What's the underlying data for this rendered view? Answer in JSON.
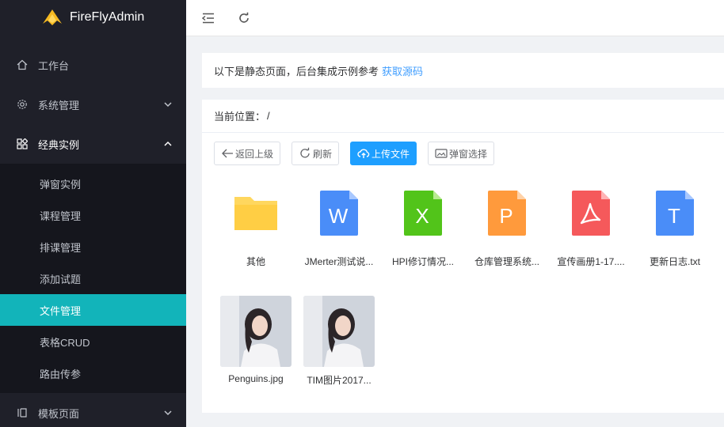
{
  "app": {
    "title": "FireFlyAdmin"
  },
  "sidebar": {
    "items": [
      {
        "label": "工作台",
        "icon": "home-icon"
      },
      {
        "label": "系统管理",
        "icon": "gear-icon"
      },
      {
        "label": "经典实例",
        "icon": "grid-icon",
        "open": true
      },
      {
        "label": "模板页面",
        "icon": "template-icon"
      }
    ],
    "subitems": [
      {
        "label": "弹窗实例"
      },
      {
        "label": "课程管理"
      },
      {
        "label": "排课管理"
      },
      {
        "label": "添加试题"
      },
      {
        "label": "文件管理",
        "active": true
      },
      {
        "label": "表格CRUD"
      },
      {
        "label": "路由传参"
      }
    ]
  },
  "notice": {
    "text": "以下是静态页面，后台集成示例参考",
    "link": "获取源码"
  },
  "breadcrumb": {
    "label": "当前位置：",
    "path": "/"
  },
  "toolbar": {
    "back_label": "返回上级",
    "refresh_label": "刷新",
    "upload_label": "上传文件",
    "select_label": "弹窗选择"
  },
  "files": [
    {
      "name": "其他",
      "type": "folder"
    },
    {
      "name": "JMerter测试说...",
      "type": "word",
      "letter": "W"
    },
    {
      "name": "HPI修订情况...",
      "type": "excel",
      "letter": "X"
    },
    {
      "name": "仓库管理系统...",
      "type": "ppt",
      "letter": "P"
    },
    {
      "name": "宣传画册1-17....",
      "type": "pdf"
    },
    {
      "name": "更新日志.txt",
      "type": "text",
      "letter": "T"
    },
    {
      "name": "Penguins.jpg",
      "type": "image"
    },
    {
      "name": "TIM图片2017...",
      "type": "image"
    }
  ],
  "colors": {
    "sidebar_bg": "#1f2029",
    "active": "#12b4ba",
    "primary": "#1e9fff",
    "word": "#4a8df8",
    "excel": "#52c41a",
    "ppt": "#ff9a3c",
    "pdf": "#f5595b",
    "folder": "#ffd75e"
  }
}
